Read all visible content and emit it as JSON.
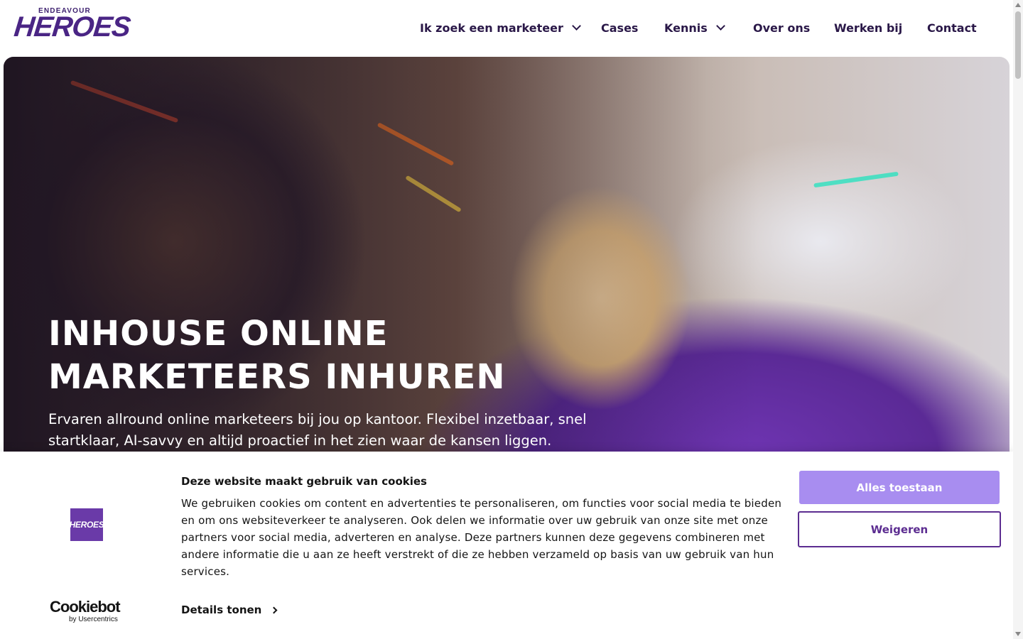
{
  "header": {
    "logo_small": "ENDEAVOUR",
    "logo_big": "HEROES",
    "nav": [
      {
        "label": "Ik zoek een marketeer",
        "has_dropdown": true
      },
      {
        "label": "Cases",
        "has_dropdown": false
      },
      {
        "label": "Kennis",
        "has_dropdown": true
      },
      {
        "label": "Over ons",
        "has_dropdown": false
      },
      {
        "label": "Werken bij",
        "has_dropdown": false
      },
      {
        "label": "Contact",
        "has_dropdown": false
      }
    ]
  },
  "hero": {
    "title_line1": "INHOUSE ONLINE",
    "title_line2": "MARKETEERS INHUREN",
    "subtitle": "Ervaren allround online marketeers bij jou op kantoor. Flexibel inzetbaar, snel startklaar, AI-savvy en altijd proactief in het zien waar de kansen liggen."
  },
  "cookie_banner": {
    "logo_text": "HEROES",
    "title": "Deze website maakt gebruik van cookies",
    "body": "We gebruiken cookies om content en advertenties te personaliseren, om functies voor social media te bieden en om ons websiteverkeer te analyseren. Ook delen we informatie over uw gebruik van onze site met onze partners voor social media, adverteren en analyse. Deze partners kunnen deze gegevens combineren met andere informatie die u aan ze heeft verstrekt of die ze hebben verzameld op basis van uw gebruik van hun services.",
    "details_label": "Details tonen",
    "provider_name": "Cookiebot",
    "provider_sub": "by Usercentrics",
    "allow_label": "Alles toestaan",
    "deny_label": "Weigeren"
  },
  "colors": {
    "brand_purple": "#5c2d91",
    "allow_button": "#a88df0",
    "nav_text": "#2a1848"
  },
  "icons": [
    "chevron-down-icon",
    "chevron-right-icon"
  ]
}
